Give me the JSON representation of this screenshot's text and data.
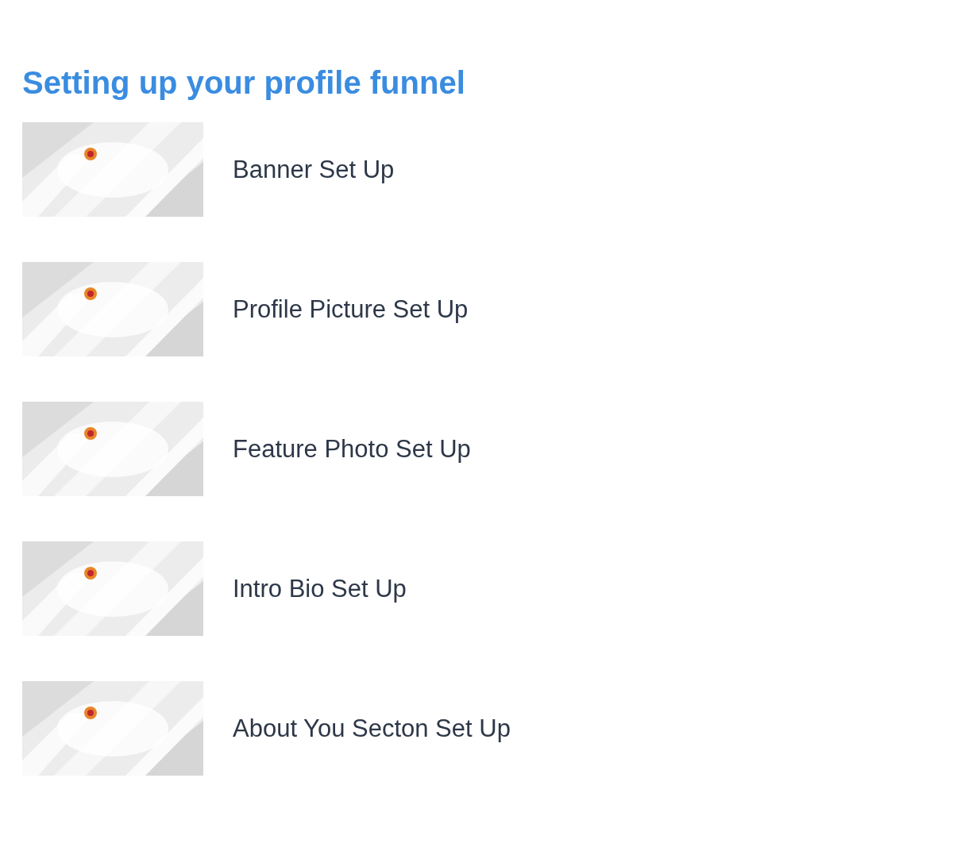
{
  "heading": "Setting up your profile funnel",
  "lessons": [
    {
      "title": "Banner Set Up"
    },
    {
      "title": "Profile Picture Set Up"
    },
    {
      "title": "Feature Photo Set Up"
    },
    {
      "title": "Intro Bio Set Up"
    },
    {
      "title": "About You Secton Set Up"
    }
  ]
}
